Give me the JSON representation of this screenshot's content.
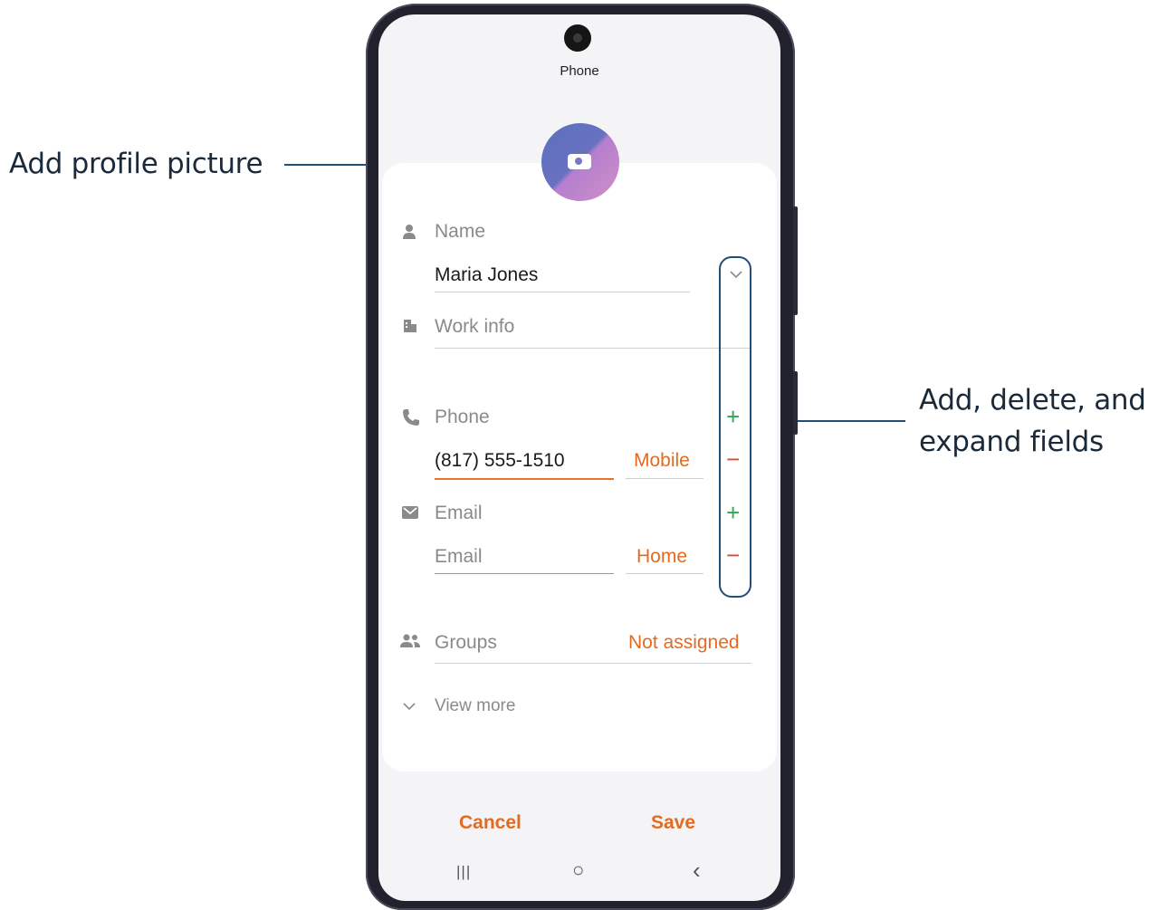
{
  "callouts": {
    "profile_picture": "Add profile picture",
    "fields_line1": "Add, delete, and",
    "fields_line2": "expand fields"
  },
  "app": {
    "title": "Phone"
  },
  "form": {
    "name_label": "Name",
    "name_value": "Maria Jones",
    "work_label": "Work info",
    "phone_label": "Phone",
    "phone_value": "(817) 555-1510",
    "phone_type": "Mobile",
    "email_label": "Email",
    "email_placeholder": "Email",
    "email_type": "Home",
    "groups_label": "Groups",
    "groups_value": "Not assigned",
    "view_more": "View more"
  },
  "actions": {
    "cancel": "Cancel",
    "save": "Save"
  },
  "nav": {
    "recents": "|||",
    "home": "○",
    "back": "‹"
  },
  "icons": {
    "person": "person-icon",
    "work": "building-icon",
    "phone": "phone-icon",
    "email": "envelope-icon",
    "groups": "people-icon"
  },
  "colors": {
    "accent": "#e46a1f",
    "add": "#2fa84f",
    "delete": "#e0453a",
    "callout": "#1f4e78"
  }
}
